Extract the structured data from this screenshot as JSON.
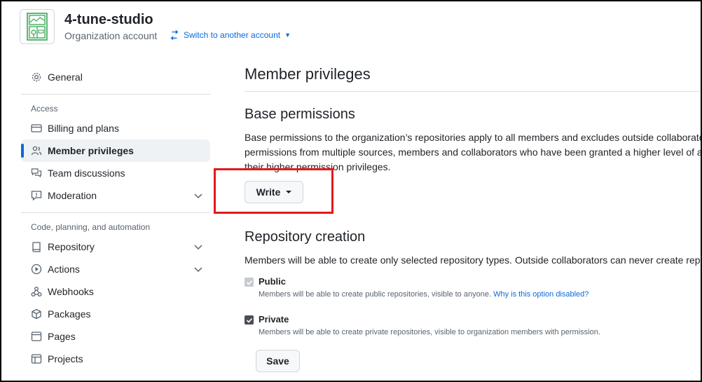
{
  "header": {
    "org_name": "4-tune-studio",
    "org_type": "Organization account",
    "switch_label": "Switch to another account"
  },
  "sidebar": {
    "general": "General",
    "section_access": "Access",
    "billing": "Billing and plans",
    "member_privileges": "Member privileges",
    "team_discussions": "Team discussions",
    "moderation": "Moderation",
    "section_code": "Code, planning, and automation",
    "repository": "Repository",
    "actions": "Actions",
    "webhooks": "Webhooks",
    "packages": "Packages",
    "pages": "Pages",
    "projects": "Projects"
  },
  "main": {
    "title": "Member privileges",
    "base": {
      "heading": "Base permissions",
      "line1": "Base permissions to the organization’s repositories apply to all members and excludes outside collaborato",
      "line2": "permissions from multiple sources, members and collaborators who have been granted a higher level of a",
      "line3": "their higher permission privileges.",
      "dropdown_value": "Write"
    },
    "repo_creation": {
      "heading": "Repository creation",
      "desc": "Members will be able to create only selected repository types. Outside collaborators can never create repo",
      "public_label": "Public",
      "public_desc": "Members will be able to create public repositories, visible to anyone.",
      "public_link": "Why is this option disabled?",
      "private_label": "Private",
      "private_desc": "Members will be able to create private repositories, visible to organization members with permission.",
      "save_label": "Save"
    }
  },
  "colors": {
    "accent": "#0969da",
    "highlight": "#e21a1a",
    "active_bg": "#eff2f5"
  }
}
